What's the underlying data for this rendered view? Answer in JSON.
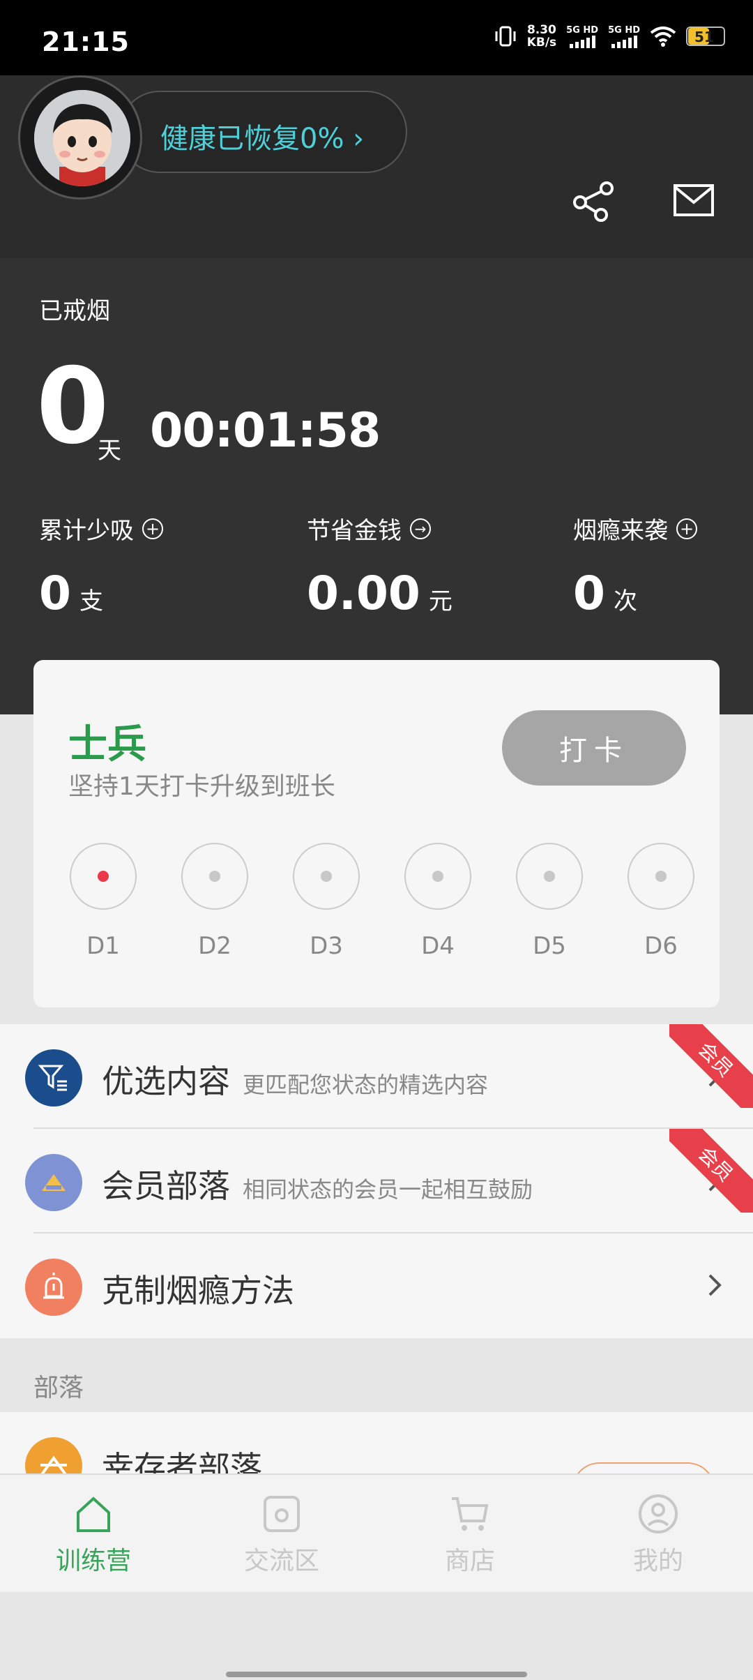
{
  "status_bar": {
    "time": "21:15",
    "net_speed_value": "8.30",
    "net_speed_unit": "KB/s",
    "signal1": "5G HD",
    "signal2": "5G HD",
    "battery": "51"
  },
  "header": {
    "health_status": "健康已恢复0% ›",
    "icons": [
      "share-icon",
      "mail-icon"
    ]
  },
  "summary": {
    "quit_label": "已戒烟",
    "days_value": "0",
    "days_unit": "天",
    "elapsed_time": "00:01:58",
    "stats": [
      {
        "label": "累计少吸",
        "icon": "+",
        "value": "0",
        "unit": "支"
      },
      {
        "label": "节省金钱",
        "icon": "→",
        "value": "0.00",
        "unit": "元"
      },
      {
        "label": "烟瘾来袭",
        "icon": "+",
        "value": "0",
        "unit": "次"
      }
    ]
  },
  "checkin": {
    "rank": "士兵",
    "subtitle": "坚持1天打卡升级到班长",
    "button": "打卡",
    "days": [
      "D1",
      "D2",
      "D3",
      "D4",
      "D5",
      "D6"
    ],
    "active_day": 0
  },
  "features": [
    {
      "title": "优选内容",
      "desc": "更匹配您状态的精选内容",
      "badge": "会员",
      "icon_color": "#1b4d8c"
    },
    {
      "title": "会员部落",
      "desc": "相同状态的会员一起相互鼓励",
      "badge": "会员",
      "icon_color": "#7f93d4"
    },
    {
      "title": "克制烟瘾方法",
      "desc": "",
      "badge": "",
      "icon_color": "#f08060"
    }
  ],
  "tribes": {
    "section_label": "部落",
    "first_title": "幸存者部落"
  },
  "tabs": [
    {
      "label": "训练营",
      "icon": "home-icon",
      "active": true
    },
    {
      "label": "交流区",
      "icon": "camera-icon",
      "active": false
    },
    {
      "label": "商店",
      "icon": "cart-icon",
      "active": false
    },
    {
      "label": "我的",
      "icon": "user-icon",
      "active": false
    }
  ],
  "colors": {
    "accent_green": "#3aa35a",
    "health_teal": "#4fd0d8",
    "dark_bg": "#323232",
    "badge_red": "#e8404a"
  }
}
